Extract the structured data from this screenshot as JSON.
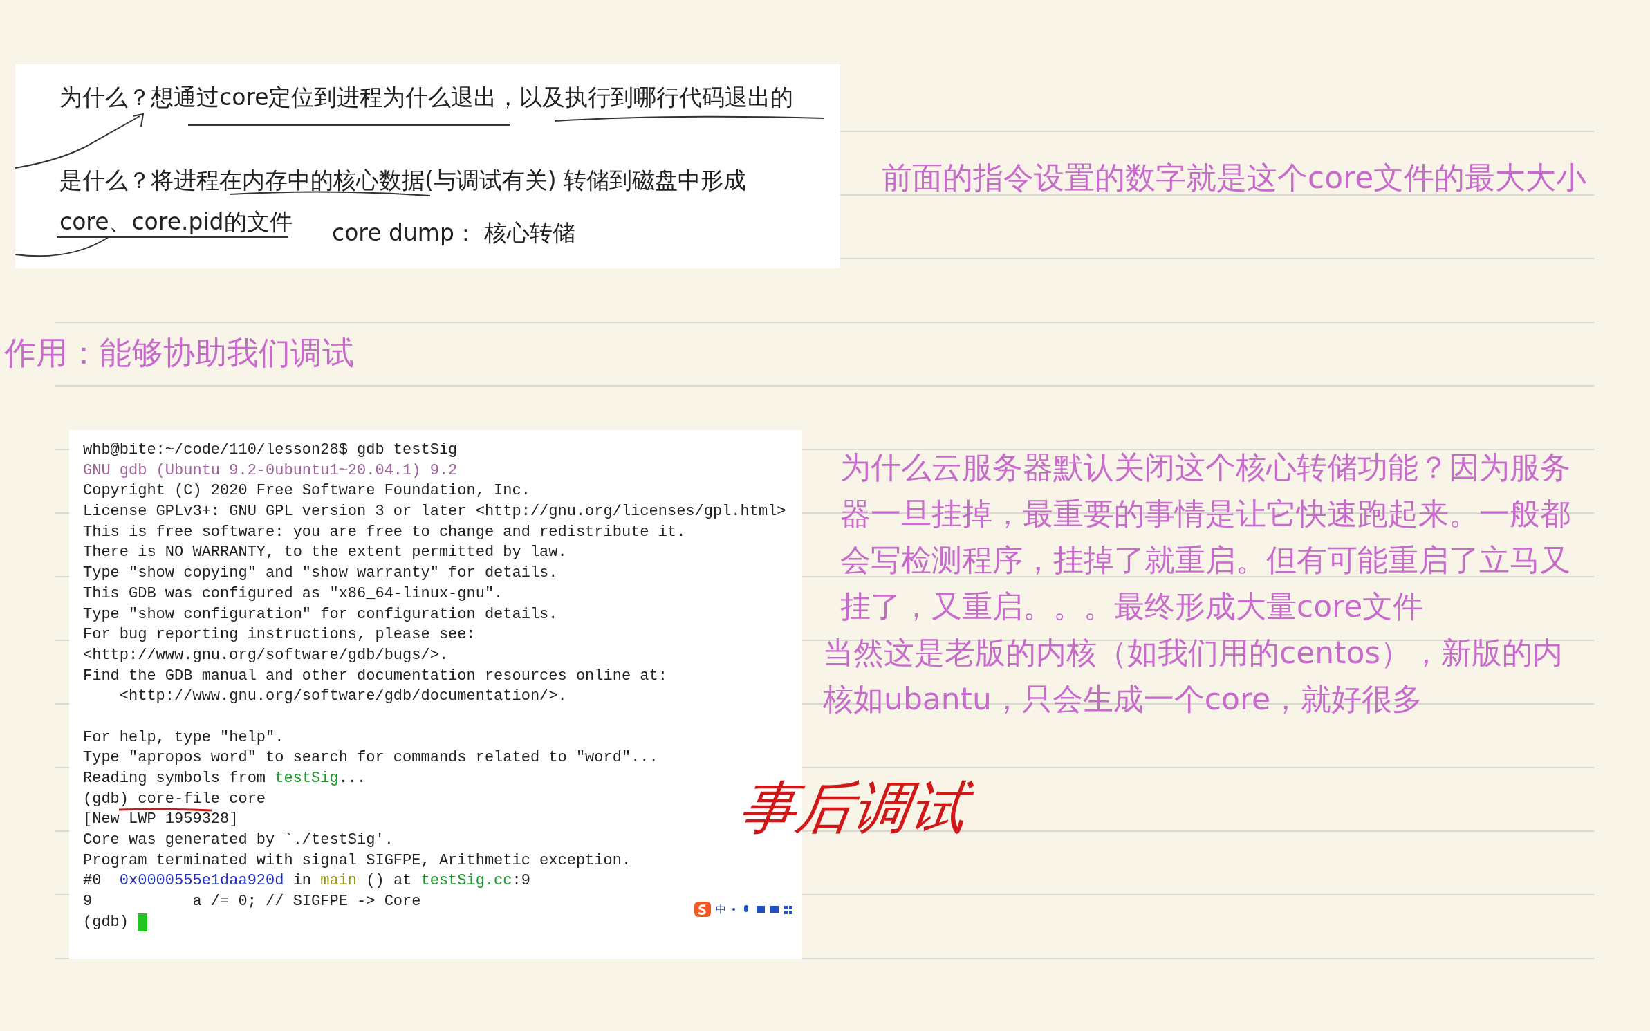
{
  "clip": {
    "lines": [
      "为什么？想通过core定位到进程为什么退出，以及执行到哪行代码退出的",
      "是什么？将进程在内存中的核心数据(与调试有关) 转储到磁盘中形成",
      "core、core.pid的文件"
    ],
    "term": "core dump：  核心转储"
  },
  "note_top": "前面的指令设置的数字就是这个core文件的最大大小",
  "heading": "作用：能够协助我们调试",
  "terminal": {
    "lines": [
      [
        {
          "text": "whb@bite:~/code/110/lesson28$ gdb testSig",
          "kind": "plain"
        }
      ],
      [
        {
          "text": "GNU gdb (Ubuntu 9.2-0ubuntu1~20.04.1) 9.2",
          "kind": "purple"
        }
      ],
      [
        {
          "text": "Copyright (C) 2020 Free Software Foundation, Inc.",
          "kind": "plain"
        }
      ],
      [
        {
          "text": "License GPLv3+: GNU GPL version 3 or later <http://gnu.org/licenses/gpl.html>",
          "kind": "plain"
        }
      ],
      [
        {
          "text": "This is free software: you are free to change and redistribute it.",
          "kind": "plain"
        }
      ],
      [
        {
          "text": "There is NO WARRANTY, to the extent permitted by law.",
          "kind": "plain"
        }
      ],
      [
        {
          "text": "Type \"show copying\" and \"show warranty\" for details.",
          "kind": "plain"
        }
      ],
      [
        {
          "text": "This GDB was configured as \"x86_64-linux-gnu\".",
          "kind": "plain"
        }
      ],
      [
        {
          "text": "Type \"show configuration\" for configuration details.",
          "kind": "plain"
        }
      ],
      [
        {
          "text": "For bug reporting instructions, please see:",
          "kind": "plain"
        }
      ],
      [
        {
          "text": "<http://www.gnu.org/software/gdb/bugs/>.",
          "kind": "plain"
        }
      ],
      [
        {
          "text": "Find the GDB manual and other documentation resources online at:",
          "kind": "plain"
        }
      ],
      [
        {
          "text": "    <http://www.gnu.org/software/gdb/documentation/>.",
          "kind": "plain"
        }
      ],
      {
        "kind": "blank"
      },
      [
        {
          "text": "For help, type \"help\".",
          "kind": "plain"
        }
      ],
      [
        {
          "text": "Type \"apropos word\" to search for commands related to \"word\"...",
          "kind": "plain"
        }
      ],
      [
        {
          "text": "Reading symbols from ",
          "kind": "plain"
        },
        {
          "text": "testSig",
          "kind": "green"
        },
        {
          "text": "...",
          "kind": "plain"
        }
      ],
      [
        {
          "text": "(gdb) core-file core",
          "kind": "plain"
        }
      ],
      [
        {
          "text": "[New LWP 1959328]",
          "kind": "plain"
        }
      ],
      [
        {
          "text": "Core was generated by `./testSig'.",
          "kind": "plain"
        }
      ],
      [
        {
          "text": "Program terminated with signal SIGFPE, Arithmetic exception.",
          "kind": "plain"
        }
      ],
      [
        {
          "text": "#0  ",
          "kind": "plain"
        },
        {
          "text": "0x0000555e1daa920d",
          "kind": "blue"
        },
        {
          "text": " in ",
          "kind": "plain"
        },
        {
          "text": "main",
          "kind": "yellow"
        },
        {
          "text": " () at ",
          "kind": "plain"
        },
        {
          "text": "testSig.cc",
          "kind": "green"
        },
        {
          "text": ":9",
          "kind": "plain"
        }
      ],
      [
        {
          "text": "9           a /= 0; // SIGFPE -> Core",
          "kind": "plain"
        }
      ],
      [
        {
          "text": "(gdb) ",
          "kind": "plain"
        }
      ]
    ],
    "cursor": true,
    "ime_label": "中"
  },
  "note_right": [
    "为什么云服务器默认关闭这个核心转储功能？因为服务器一旦挂掉，最重要的事情是让它快速跑起来。一般都会写检测程序，挂掉了就重启。但有可能重启了立马又挂了，又重启。。。最终形成大量core文件",
    "当然这是老版的内核（如我们用的centos），新版的内核如ubantu，只会生成一个core，就好很多"
  ],
  "handwriting": "事后调试"
}
